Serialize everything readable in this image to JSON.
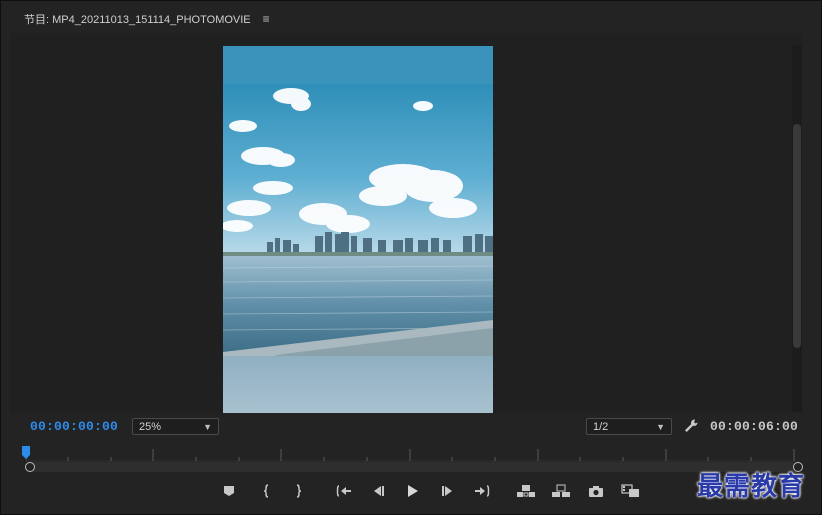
{
  "panel": {
    "title": "节目: MP4_20211013_151114_PHOTOMOVIE",
    "menu_icon": "hamburger-icon"
  },
  "viewer": {
    "current_time": "00:00:00:00",
    "duration": "00:00:06:00",
    "zoom": "25%",
    "resolution": "1/2",
    "settings_icon": "wrench-icon"
  },
  "transport_icons": [
    "add-marker-icon",
    "mark-in-icon",
    "mark-out-icon",
    "go-to-in-icon",
    "step-back-icon",
    "play-icon",
    "step-forward-icon",
    "go-to-out-icon",
    "lift-icon",
    "extract-icon",
    "export-frame-icon",
    "comparison-view-icon"
  ],
  "watermark": "最需教育",
  "colors": {
    "accent_timecode": "#2d8ceb",
    "background": "#232323",
    "watermark": "#2a3aa8"
  }
}
